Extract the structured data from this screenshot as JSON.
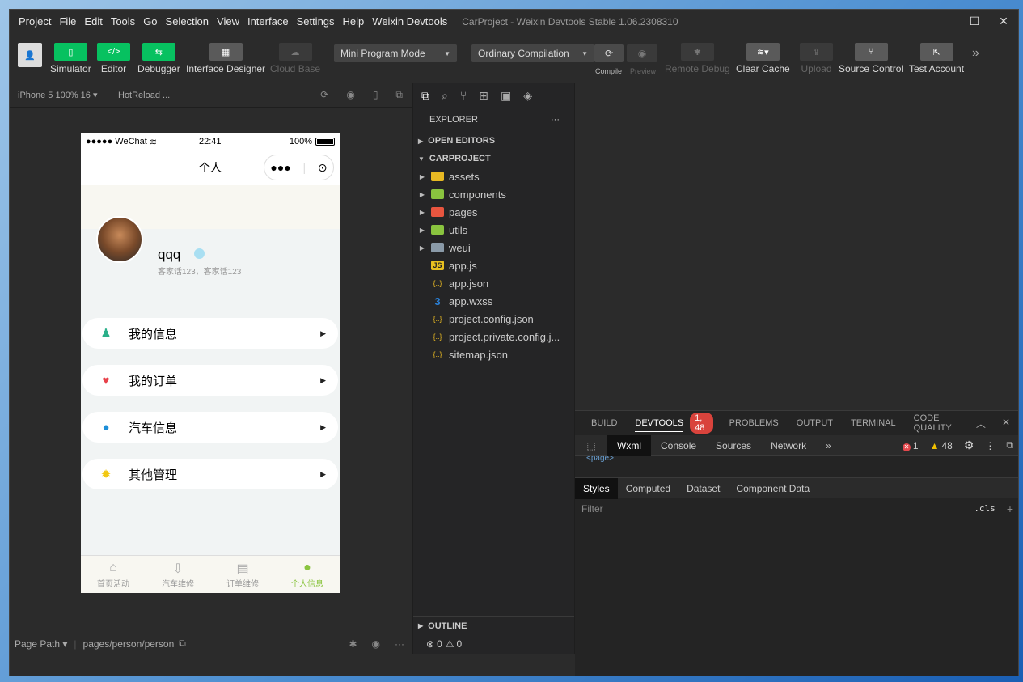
{
  "menubar": {
    "items": [
      "Project",
      "File",
      "Edit",
      "Tools",
      "Go",
      "Selection",
      "View",
      "Interface",
      "Settings",
      "Help",
      "Weixin Devtools"
    ],
    "title": "CarProject - Weixin Devtools Stable 1.06.2308310"
  },
  "toolbar": {
    "simulator": "Simulator",
    "editor": "Editor",
    "debugger": "Debugger",
    "interface_designer": "Interface Designer",
    "cloud_base": "Cloud Base",
    "mode_select": "Mini Program Mode",
    "compile_select": "Ordinary Compilation",
    "compile": "Compile",
    "preview": "Preview",
    "remote_debug": "Remote Debug",
    "clear_cache": "Clear Cache",
    "upload": "Upload",
    "source_control": "Source Control",
    "test_account": "Test Account"
  },
  "simulator": {
    "device": "iPhone 5 100% 16",
    "hotreload": "HotReload ...",
    "status": {
      "carrier": "●●●●● WeChat",
      "time": "22:41",
      "battery": "100%"
    },
    "nav_title": "个人",
    "profile": {
      "name": "qqq",
      "desc": "客家话123，客家话123"
    },
    "menu": [
      {
        "label": "我的信息",
        "icon": "person-icon",
        "color": "#2bb08a"
      },
      {
        "label": "我的订单",
        "icon": "heart-icon",
        "color": "#e8424b"
      },
      {
        "label": "汽车信息",
        "icon": "pen-icon",
        "color": "#1e8fd8"
      },
      {
        "label": "其他管理",
        "icon": "gear-icon",
        "color": "#f2c811"
      }
    ],
    "tabs": [
      {
        "label": "首页活动",
        "icon": "home-icon"
      },
      {
        "label": "汽车维修",
        "icon": "download-icon"
      },
      {
        "label": "订单维修",
        "icon": "message-icon"
      },
      {
        "label": "个人信息",
        "icon": "user-icon",
        "active": true
      }
    ],
    "footer": {
      "page_path_label": "Page Path",
      "page_path": "pages/person/person"
    }
  },
  "explorer": {
    "header": "EXPLORER",
    "open_editors": "OPEN EDITORS",
    "project": "CARPROJECT",
    "files": [
      {
        "name": "assets",
        "type": "folder",
        "color": "#e8b923"
      },
      {
        "name": "components",
        "type": "folder",
        "color": "#8ac43f"
      },
      {
        "name": "pages",
        "type": "folder",
        "color": "#e8553f"
      },
      {
        "name": "utils",
        "type": "folder",
        "color": "#8ac43f"
      },
      {
        "name": "weui",
        "type": "folder",
        "color": "#8a9aa8"
      },
      {
        "name": "app.js",
        "type": "js",
        "color": "#e8c020"
      },
      {
        "name": "app.json",
        "type": "json",
        "color": "#e8b923"
      },
      {
        "name": "app.wxss",
        "type": "css",
        "color": "#2a7fd4"
      },
      {
        "name": "project.config.json",
        "type": "json",
        "color": "#e8b923"
      },
      {
        "name": "project.private.config.j...",
        "type": "json",
        "color": "#e8b923"
      },
      {
        "name": "sitemap.json",
        "type": "json",
        "color": "#e8b923"
      }
    ],
    "outline": "OUTLINE",
    "footer": {
      "errors": "0",
      "warnings": "0"
    }
  },
  "panel": {
    "tabs": [
      "BUILD",
      "DEVTOOLS",
      "PROBLEMS",
      "OUTPUT",
      "TERMINAL",
      "CODE QUALITY"
    ],
    "badge": "1, 48",
    "devtools_tabs": [
      "Wxml",
      "Console",
      "Sources",
      "Network"
    ],
    "errors": "1",
    "warnings": "48",
    "dom_line": "<page>",
    "style_tabs": [
      "Styles",
      "Computed",
      "Dataset",
      "Component Data"
    ],
    "filter_placeholder": "Filter",
    "cls": ".cls"
  }
}
